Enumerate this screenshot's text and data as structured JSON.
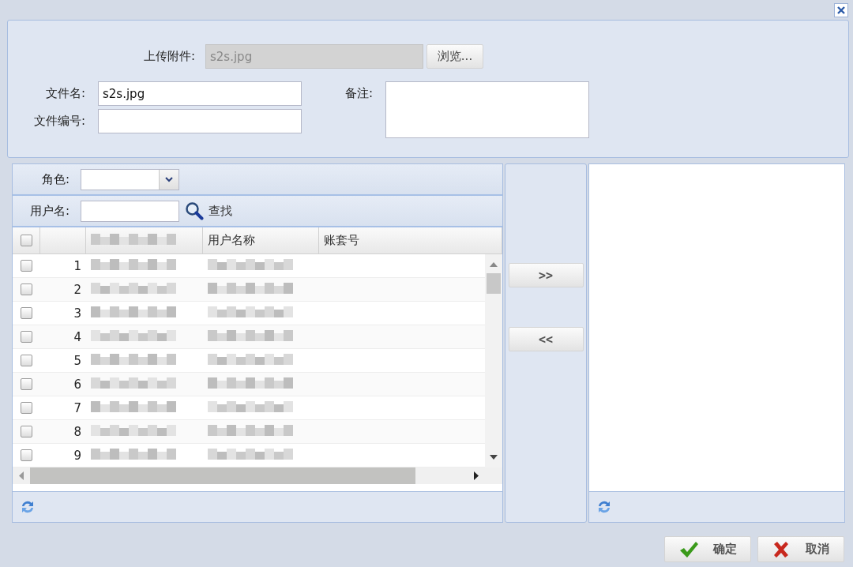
{
  "upload": {
    "label": "上传附件:",
    "value": "s2s.jpg",
    "disabled": true,
    "browse": "浏览..."
  },
  "fields": [
    {
      "label": "文件名:",
      "value": "s2s.jpg"
    },
    {
      "label": "文件编号:"
    }
  ],
  "remark": {
    "label": "备注:"
  },
  "role": {
    "label": "角色:"
  },
  "user_search": {
    "label": "用户名:",
    "button": "查找"
  },
  "table": {
    "header_checked": false,
    "columns": [
      {
        "redacted": true
      },
      {
        "label": "用户名称",
        "redacted": false
      },
      {
        "label": "账套号",
        "redacted": false
      }
    ],
    "rows": [
      {
        "number": "1",
        "checked": false,
        "redacted": true
      },
      {
        "number": "2",
        "checked": false,
        "redacted": true
      },
      {
        "number": "3",
        "checked": false,
        "redacted": true
      },
      {
        "number": "4",
        "checked": false,
        "redacted": true
      },
      {
        "number": "5",
        "checked": false,
        "redacted": true
      },
      {
        "number": "6",
        "checked": false,
        "redacted": true
      },
      {
        "number": "7",
        "checked": false,
        "redacted": true
      },
      {
        "number": "8",
        "checked": false,
        "redacted": true
      },
      {
        "number": "9",
        "checked": false,
        "redacted": true
      }
    ]
  },
  "move_buttons": [
    ">>",
    "<<"
  ],
  "buttons": [
    {
      "kind": "ok",
      "label": "确定"
    },
    {
      "kind": "cancel",
      "label": "取消"
    }
  ]
}
